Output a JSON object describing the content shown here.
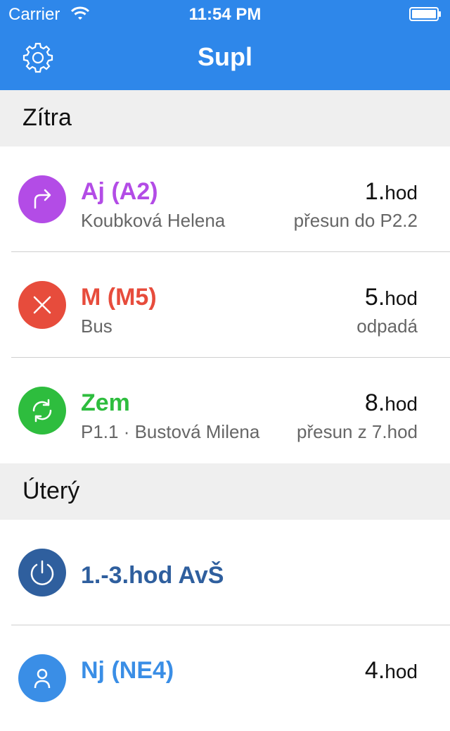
{
  "status_bar": {
    "carrier": "Carrier",
    "time": "11:54 PM"
  },
  "nav": {
    "title": "Supl"
  },
  "colors": {
    "nav_bg": "#2e87ea",
    "purple": "#b34ce6",
    "red": "#e74c3c",
    "green": "#2ebd3e",
    "navy": "#2f5f9e",
    "blue": "#3a8ee6"
  },
  "sections": [
    {
      "label": "Zítra",
      "rows": [
        {
          "icon": "redirect-arrow-icon",
          "color": "#b34ce6",
          "subject": "Aj (A2)",
          "subtitle": "Koubková Helena",
          "hour_num": "1.",
          "hour_unit": "hod",
          "note": "přesun do P2.2"
        },
        {
          "icon": "close-x-icon",
          "color": "#e74c3c",
          "subject": "M (M5)",
          "subtitle": "Bus",
          "hour_num": "5.",
          "hour_unit": "hod",
          "note": "odpadá"
        },
        {
          "icon": "swap-refresh-icon",
          "color": "#2ebd3e",
          "subject": "Zem",
          "subtitle": "P1.1 · Bustová Milena",
          "hour_num": "8.",
          "hour_unit": "hod",
          "note": "přesun z 7.hod"
        }
      ]
    },
    {
      "label": "Úterý",
      "rows": [
        {
          "icon": "power-clock-icon",
          "color": "#2f5f9e",
          "subject": "1.-3.hod AvŠ"
        },
        {
          "icon": "person-icon",
          "color": "#3a8ee6",
          "subject": "Nj (NE4)",
          "hour_num": "4.",
          "hour_unit": "hod"
        }
      ]
    }
  ]
}
